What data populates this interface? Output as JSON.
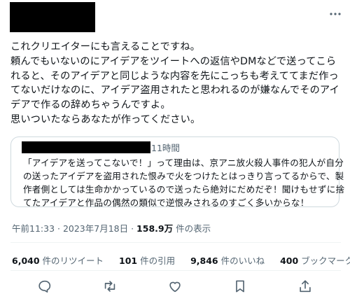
{
  "tweet": {
    "text_lines": [
      "これクリエイターにも言えることですね。",
      "頼んでもいないのにアイデアをツイートへの返信やDMなどで送ってこら",
      "れると、そのアイデアと同じような内容を先にこっちも考えててまだ作っ",
      "てないだけなのに、アイデア盗用されたと思われるのが嫌なんでそのアイ",
      "デアで作るの辞めちゃうんですよ。",
      "思いついたならあなたが作ってください。"
    ]
  },
  "quote": {
    "time": "11時間",
    "text_lines": [
      "「アイデアを送ってこないで！」って理由は、京アニ放火殺人事件の犯人が自分",
      "の送ったアイデアを盗用された恨みで火をつけたとはっきり言ってるからで、製",
      "作者側としては生命かかっているので送ったら絶対にだめだぞ！聞けもせずに捨",
      "てたアイデアと作品の偶然の類似で逆恨みされるのすごく多いからな！"
    ]
  },
  "meta": {
    "time": "午前11:33",
    "sep1": " · ",
    "date": "2023年7月18日",
    "sep2": " · ",
    "views": "158.9万",
    "views_label": " 件の表示"
  },
  "stats": {
    "retweets": {
      "num": "6,040",
      "label": " 件のリツイート"
    },
    "quotes": {
      "num": "101",
      "label": " 件の引用"
    },
    "likes": {
      "num": "9,846",
      "label": " 件のいいね"
    },
    "bookmarks": {
      "num": "400",
      "label": " ブックマーク"
    }
  },
  "actions": [
    "reply-icon",
    "retweet-icon",
    "like-icon",
    "bookmark-icon",
    "share-icon"
  ]
}
